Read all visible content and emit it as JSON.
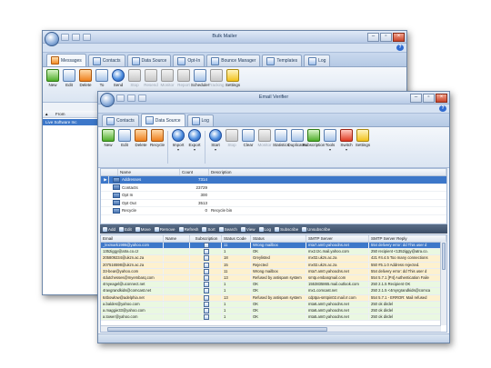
{
  "bulk": {
    "title": "Bulk Mailer",
    "tabs": [
      "Messages",
      "Contacts",
      "Data Source",
      "Opt-In",
      "Bounce Manager",
      "Templates",
      "Log"
    ],
    "ribbon": [
      "New",
      "Edit",
      "Delete",
      "To",
      "Send",
      "Stop",
      "Resend",
      "Monitor",
      "Report",
      "Scheduler",
      "Tracking",
      "Settings"
    ],
    "tree_header": "From",
    "tree_item": "Live Software Inc"
  },
  "ev": {
    "title": "Email Verifier",
    "tabs": [
      "Contacts",
      "Data Source",
      "Log"
    ],
    "ribbon": [
      "New",
      "Edit",
      "Delete",
      "Recycle",
      "Import",
      "Export",
      "Start",
      "Stop",
      "Clear",
      "Monitor",
      "Statistics",
      "Duplicates",
      "Subscription",
      "Tools",
      "Switch",
      "Settings"
    ],
    "ds_headers": [
      "Name",
      "Count",
      "Description"
    ],
    "ds_rows": [
      {
        "name": "Addresses",
        "count": "7314",
        "desc": ""
      },
      {
        "name": "Contacts",
        "count": "23729",
        "desc": ""
      },
      {
        "name": "Opt In",
        "count": "300",
        "desc": ""
      },
      {
        "name": "Opt Out",
        "count": "3513",
        "desc": ""
      },
      {
        "name": "Recycle",
        "count": "0",
        "desc": "Recycle bin"
      }
    ],
    "toolbar": [
      "Add",
      "Edit",
      "Move",
      "Remove",
      "Refresh",
      "Sort",
      "Search",
      "View",
      "Log",
      "Subscribe",
      "Unsubscribe"
    ],
    "grid_headers": [
      "Email",
      "Name",
      "Subscription",
      "Status Code",
      "Status",
      "SMTP Server",
      "SMTP Server Reply"
    ],
    "grid_rows": [
      {
        "email": "_lexmark1986@yahoo.com",
        "name": "",
        "code": "11",
        "status": "Wrong mailbox",
        "smtp": "mta7.am0.yahoodns.net",
        "reply": "554 delivery error: dd This user d",
        "kind": "sel"
      },
      {
        "email": "1352iggy@atra.co.cz",
        "name": "",
        "code": "1",
        "status": "OK",
        "smtp": "mx2.tzc.mail.yahoo.com",
        "reply": "250 recipient <1352iggy@atra.co.",
        "kind": "ok"
      },
      {
        "email": "205809234@ukzn.ac.za",
        "name": "",
        "code": "18",
        "status": "Greylisted",
        "smtp": "mx02.ukzn.ac.za",
        "reply": "421 #4.4.5 Too many connections",
        "kind": "bad"
      },
      {
        "email": "207516598@ukzn.ac.za",
        "name": "",
        "code": "15",
        "status": "Rejected",
        "smtp": "mx02.ukzn.ac.za",
        "reply": "550 #5.1.0 Address rejected.",
        "kind": "bad"
      },
      {
        "email": "33-bear@yahoo.com",
        "name": "",
        "code": "11",
        "status": "Wrong mailbox",
        "smtp": "mta7.am0.yahoodns.net",
        "reply": "554 delivery error: dd This user d",
        "kind": "bad"
      },
      {
        "email": "4dutchesses@myembarq.com",
        "name": "",
        "code": "13",
        "status": "Refused by antispam system",
        "smtp": "smtp.embarqmail.com",
        "reply": "554 5.7.1 [P4] Authentication Faile",
        "kind": "bad"
      },
      {
        "email": "4myeagel@uconnect.net",
        "name": "",
        "code": "1",
        "status": "OK",
        "smtp": "1553835865.mail.outlook.com",
        "reply": "250 2.1.5 Recipient OK",
        "kind": "ok"
      },
      {
        "email": "4ravgrandkids@comcast.net",
        "name": "",
        "code": "1",
        "status": "OK",
        "smtp": "mx1.comcast.net",
        "reply": "250 2.1.5 <4myrgrandkids@comca",
        "kind": "ok"
      },
      {
        "email": "64bowlow@adelphia.net",
        "name": "",
        "code": "13",
        "status": "Refused by antispam system",
        "smtp": "cdptpa-smtpin02.mail.rr.com",
        "reply": "554 5.7.1 - ERROR: Mail refused",
        "kind": "bad"
      },
      {
        "email": "a.baldes@yahoo.com",
        "name": "",
        "code": "1",
        "status": "OK",
        "smtp": "mta6.am0.yahoodns.net",
        "reply": "250 ok dirdel",
        "kind": "ok"
      },
      {
        "email": "a.maggie33@yahoo.com",
        "name": "",
        "code": "1",
        "status": "OK",
        "smtp": "mta6.am0.yahoodns.net",
        "reply": "250 ok dirdel",
        "kind": "ok"
      },
      {
        "email": "a.tower@yahoo.com",
        "name": "",
        "code": "1",
        "status": "OK",
        "smtp": "mta5.am0.yahoodns.net",
        "reply": "250 ok dirdel",
        "kind": "ok"
      }
    ]
  },
  "colors": {
    "accent": "#3c77c9",
    "ok_row": "#eaf8e1",
    "warn_row": "#fdf1cf",
    "toolbar": "#4a5d78"
  }
}
